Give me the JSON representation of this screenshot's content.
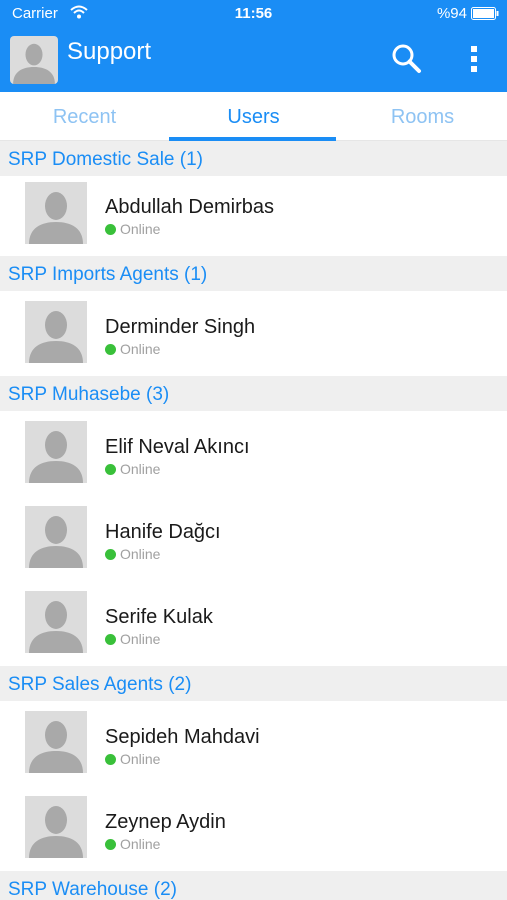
{
  "status_bar": {
    "carrier": "Carrier",
    "time": "11:56",
    "battery": "%94"
  },
  "app_bar": {
    "title": "Support"
  },
  "tabs": [
    {
      "label": "Recent",
      "active": false
    },
    {
      "label": "Users",
      "active": true
    },
    {
      "label": "Rooms",
      "active": false
    }
  ],
  "groups": [
    {
      "title": "SRP Domestic Sale (1)",
      "users": [
        {
          "name": "Abdullah Demirbas",
          "status": "Online"
        }
      ]
    },
    {
      "title": "SRP Imports Agents (1)",
      "users": [
        {
          "name": "Derminder Singh",
          "status": "Online"
        }
      ]
    },
    {
      "title": "SRP Muhasebe (3)",
      "users": [
        {
          "name": "Elif Neval Akıncı",
          "status": "Online"
        },
        {
          "name": "Hanife Dağcı",
          "status": "Online"
        },
        {
          "name": "Serife Kulak",
          "status": "Online"
        }
      ]
    },
    {
      "title": "SRP Sales Agents (2)",
      "users": [
        {
          "name": "Sepideh Mahdavi",
          "status": "Online"
        },
        {
          "name": "Zeynep Aydin",
          "status": "Online"
        }
      ]
    },
    {
      "title": "SRP Warehouse (2)",
      "users": []
    }
  ],
  "colors": {
    "accent": "#1a8df5",
    "online": "#39c03a",
    "section_bg": "#efefef"
  },
  "icons": {
    "search": "search-icon",
    "more": "more-vertical-icon",
    "wifi": "wifi-icon",
    "battery": "battery-icon",
    "avatar": "person-placeholder-icon"
  }
}
